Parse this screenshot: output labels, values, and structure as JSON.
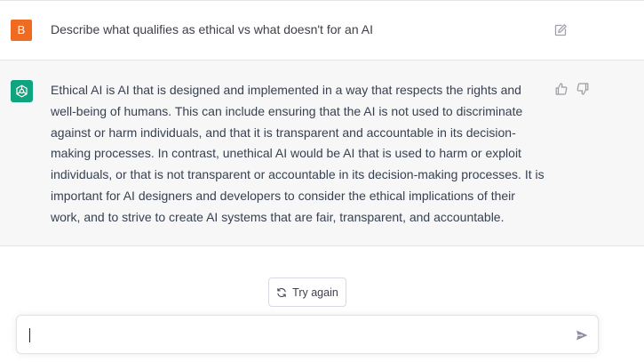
{
  "conversation": {
    "user_message": {
      "avatar_letter": "B",
      "text": "Describe what qualifies as ethical vs what doesn't for an AI"
    },
    "assistant_message": {
      "text": "Ethical AI is AI that is designed and implemented in a way that respects the rights and well-being of humans. This can include ensuring that the AI is not used to discriminate against or harm individuals, and that it is transparent and accountable in its decision-making processes. In contrast, unethical AI would be AI that is used to harm or exploit individuals, or that is not transparent or accountable in its decision-making processes. It is important for AI designers and developers to consider the ethical implications of their work, and to strive to create AI systems that are fair, transparent, and accountable."
    }
  },
  "actions": {
    "try_again_label": "Try again"
  },
  "composer": {
    "value": "",
    "placeholder": ""
  },
  "icons": {
    "edit": "edit-icon",
    "thumbs_up": "thumbs-up-icon",
    "thumbs_down": "thumbs-down-icon",
    "refresh": "refresh-icon",
    "send": "send-icon",
    "assistant_logo": "openai-logo-icon"
  },
  "colors": {
    "user_avatar": "#f06b22",
    "assistant_avatar": "#10a37f",
    "assistant_bg": "#f7f7f8"
  }
}
